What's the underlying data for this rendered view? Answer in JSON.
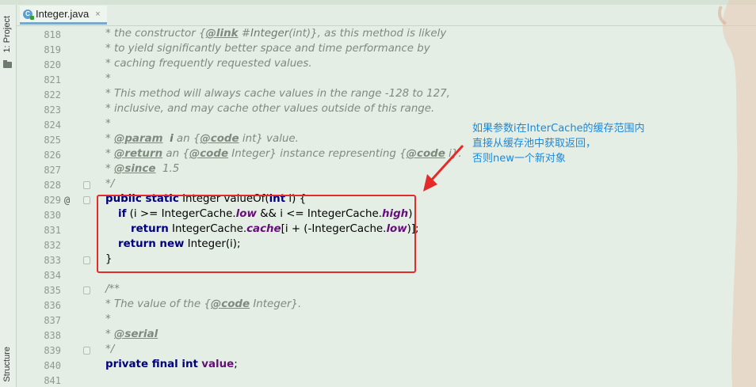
{
  "sidebar": {
    "project_label": "1: Project",
    "structure_label": "Structure"
  },
  "tab": {
    "label": "Integer.java",
    "icon_letter": "C",
    "close": "×"
  },
  "gutter": {
    "line_numbers": [
      "818",
      "819",
      "820",
      "821",
      "822",
      "823",
      "824",
      "825",
      "826",
      "827",
      "828",
      "829",
      "830",
      "831",
      "832",
      "833",
      "834",
      "835",
      "836",
      "837",
      "838",
      "839",
      "840",
      "841"
    ],
    "override_marker": "@"
  },
  "code": {
    "l818": "* the constructor {",
    "l818_tag": "@link",
    "l818_b": " #",
    "l818_c": "Integer",
    "l818_d": "(int)}, as this method is likely",
    "l819": "* to yield significantly better space and time performance by",
    "l820": "* caching frequently requested values.",
    "l821": "*",
    "l822": "* This method will always cache values in the range -128 to 127,",
    "l823": "* inclusive, and may cache other values outside of this range.",
    "l824": "*",
    "l825_a": "* ",
    "l825_tag": "@param",
    "l825_b": "  ",
    "l825_c": "i",
    "l825_d": " an {",
    "l825_tag2": "@code",
    "l825_e": " int} value.",
    "l826_a": "* ",
    "l826_tag": "@return",
    "l826_b": " an {",
    "l826_tag2": "@code",
    "l826_c": " Integer} instance representing {",
    "l826_tag3": "@code",
    "l826_d": " i}.",
    "l827_a": "* ",
    "l827_tag": "@since",
    "l827_b": "  1.5",
    "l828": "*/",
    "l829_kw": "public static",
    "l829_a": " Integer valueOf(",
    "l829_kw2": "int",
    "l829_b": " i) {",
    "l830_kw": "if",
    "l830_a": " (i >= IntegerCache.",
    "l830_f": "low",
    "l830_b": " && i <= IntegerCache.",
    "l830_f2": "high",
    "l830_c": ")",
    "l831_kw": "return",
    "l831_a": " IntegerCache.",
    "l831_f": "cache",
    "l831_b": "[i + (-IntegerCache.",
    "l831_f2": "low",
    "l831_c": ")];",
    "l832_kw": "return new",
    "l832_a": " Integer(i);",
    "l833": "}",
    "l835": "/**",
    "l836_a": "* The value of the {",
    "l836_tag": "@code",
    "l836_b": " Integer}.",
    "l837": "*",
    "l838_a": "* ",
    "l838_tag": "@serial",
    "l839": "*/",
    "l840_kw": "private final int",
    "l840_f": "value",
    "l840_b": ";"
  },
  "annotation": {
    "line1": "如果参数i在InterCache的缓存范围内",
    "line2": "直接从缓存池中获取返回，",
    "line3": "否则new一个新对象"
  },
  "colors": {
    "highlight_border": "#e52a2a",
    "annotation_text": "#1e88d8",
    "keyword": "#000080",
    "field": "#660e7a"
  }
}
